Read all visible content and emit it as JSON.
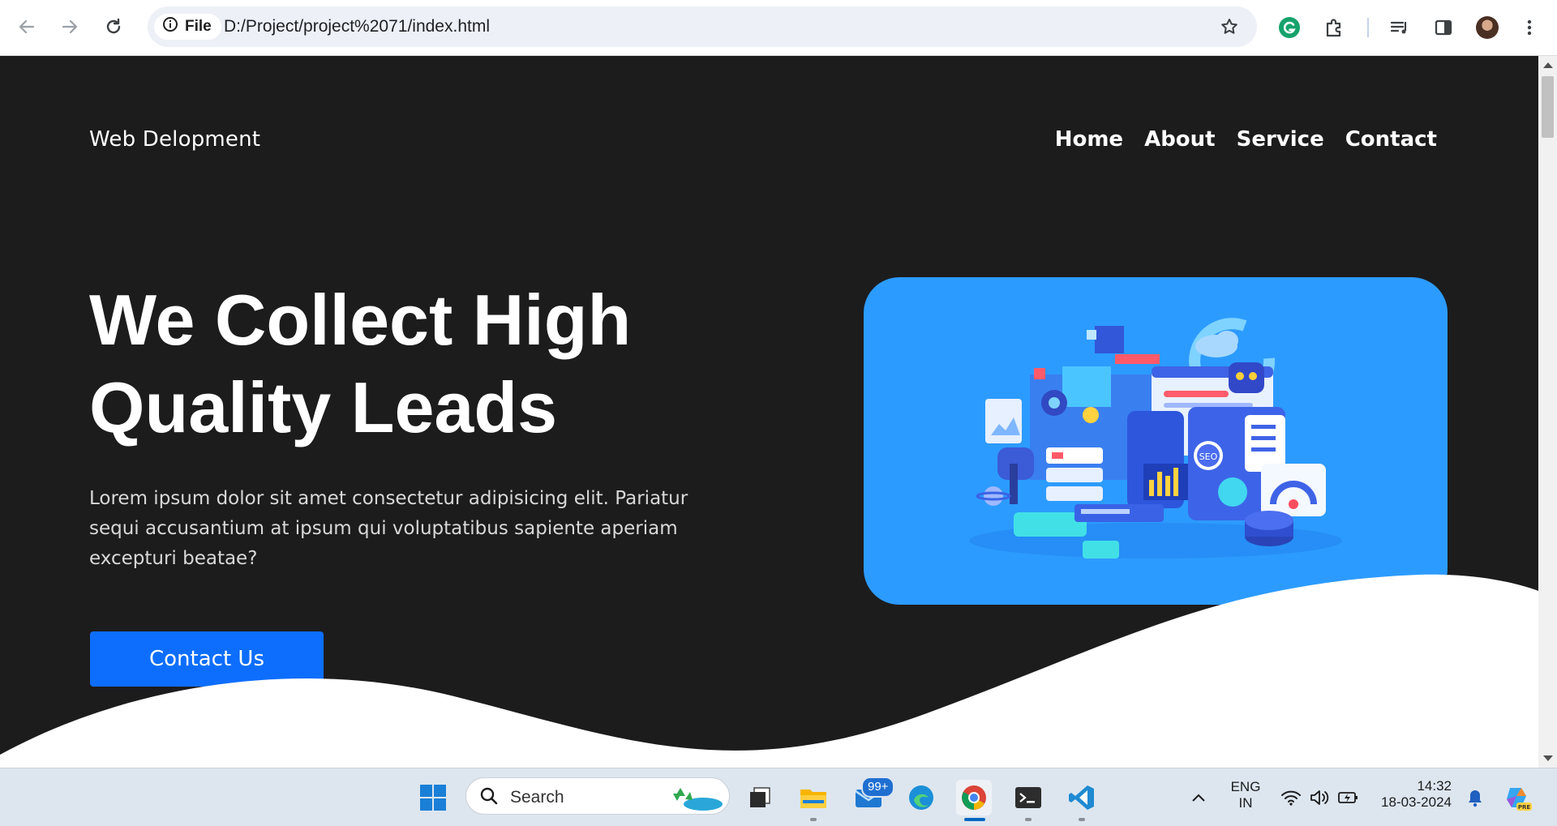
{
  "browser": {
    "chip_label": "File",
    "url": "D:/Project/project%2071/index.html"
  },
  "site": {
    "brand": "Web Delopment",
    "nav": [
      "Home",
      "About",
      "Service",
      "Contact"
    ],
    "hero": {
      "title_line1": "We Collect High",
      "title_line2": "Quality Leads",
      "text": "Lorem ipsum dolor sit amet consectetur adipisicing elit. Pariatur sequi accusantium at ipsum qui voluptatibus sapiente aperiam excepturi beatae?",
      "cta": "Contact Us"
    },
    "colors": {
      "background": "#1c1c1d",
      "accent": "#0d6efd",
      "image_bg": "#2c9bff"
    }
  },
  "taskbar": {
    "search_placeholder": "Search",
    "mail_badge": "99+",
    "language_line1": "ENG",
    "language_line2": "IN",
    "time": "14:32",
    "date": "18-03-2024"
  },
  "icons": {
    "illustration": "seo-marketing-3d-illustration",
    "seo_label": "SEO"
  }
}
